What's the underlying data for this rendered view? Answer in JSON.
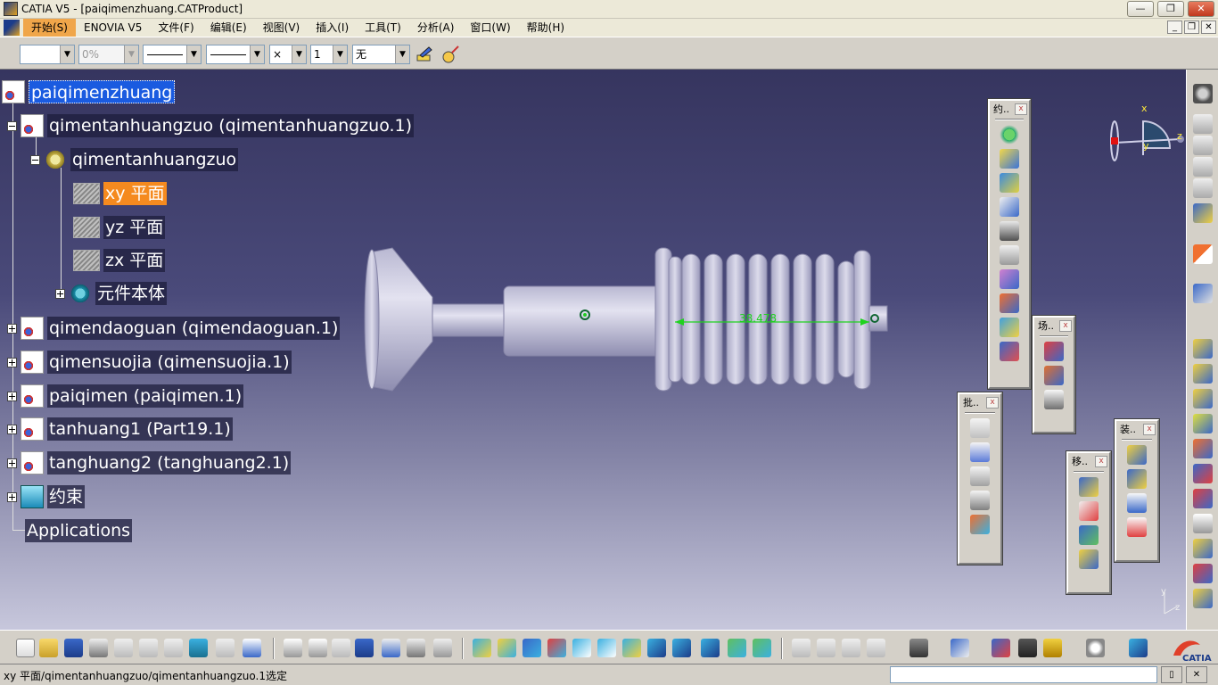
{
  "window": {
    "title": "CATIA V5 - [paiqimenzhuang.CATProduct]",
    "minimize": "—",
    "maximize": "❐",
    "close": "✕"
  },
  "menu": {
    "items": [
      "开始(S)",
      "ENOVIA V5",
      "文件(F)",
      "编辑(E)",
      "视图(V)",
      "插入(I)",
      "工具(T)",
      "分析(A)",
      "窗口(W)",
      "帮助(H)"
    ],
    "active_index": 0,
    "mdi_minimize": "_",
    "mdi_restore": "❐",
    "mdi_close": "✕"
  },
  "properties_toolbar": {
    "color_value": "",
    "transparency_value": "0%",
    "linetype_symbol": "×",
    "layer_value": "1",
    "layer_combo_value": "无"
  },
  "tree": {
    "root": "paiqimenzhuang",
    "nodes": [
      {
        "label": "qimentanhuangzuo (qimentanhuangzuo.1)"
      },
      {
        "label": "qimentanhuangzuo"
      },
      {
        "label": "xy 平面"
      },
      {
        "label": "yz 平面"
      },
      {
        "label": "zx 平面"
      },
      {
        "label": "元件本体"
      },
      {
        "label": "qimendaoguan (qimendaoguan.1)"
      },
      {
        "label": "qimensuojia (qimensuojia.1)"
      },
      {
        "label": "paiqimen (paiqimen.1)"
      },
      {
        "label": "tanhuang1 (Part19.1)"
      },
      {
        "label": "tanghuang2 (tanghuang2.1)"
      },
      {
        "label": "约束"
      },
      {
        "label": "Applications"
      }
    ]
  },
  "model": {
    "dimension_label": "38.478"
  },
  "compass": {
    "x_label": "x",
    "y_label": "y",
    "z_label": "z"
  },
  "floating_toolbars": {
    "constraints_title": "约..",
    "scene_title": "场..",
    "annotation_title": "批..",
    "move_title": "移..",
    "assembly_title": "装.."
  },
  "small_axis": {
    "y_label": "y",
    "z_label": "z"
  },
  "status": {
    "message": "xy 平面/qimentanhuangzuo/qimentanhuangzuo.1选定"
  },
  "colors": {
    "viewport_top": "#36355f",
    "viewport_bottom": "#c7c7dc",
    "selection_highlight": "#f58a1f",
    "root_selection": "#1a5be0",
    "model_surface": "#c9c8de",
    "dimension_green": "#1fd21f"
  }
}
